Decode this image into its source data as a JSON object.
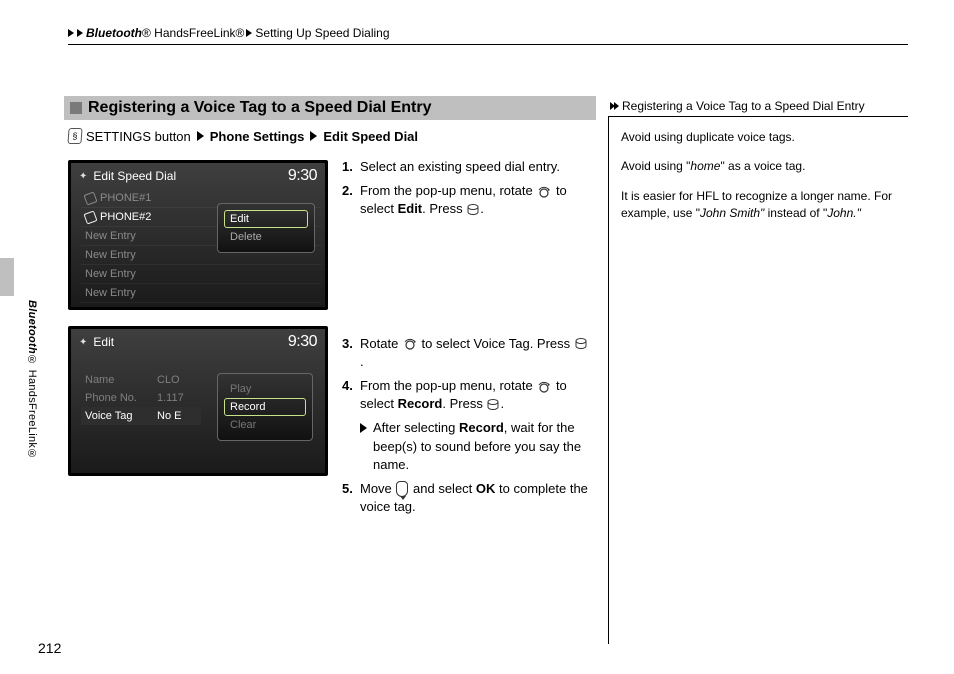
{
  "breadcrumb": {
    "a": "Bluetooth",
    "a_reg": "®",
    "b": " HandsFreeLink®",
    "c": "Setting Up Speed Dialing"
  },
  "side": {
    "a": "Bluetooth",
    "reg": "®",
    "b": " HandsFreeLink®"
  },
  "section_title": "Registering a Voice Tag to a Speed Dial Entry",
  "nav": {
    "a": "SETTINGS button",
    "b": "Phone Settings",
    "c": "Edit Speed Dial"
  },
  "shot1": {
    "title": "Edit Speed Dial",
    "time": "9:30",
    "rows": [
      "PHONE#1",
      "PHONE#2",
      "New Entry",
      "New Entry",
      "New Entry",
      "New Entry"
    ],
    "popup": [
      "Edit",
      "Delete"
    ]
  },
  "shot2": {
    "title": "Edit",
    "time": "9:30",
    "rows": [
      {
        "l": "Name",
        "v": "CLO"
      },
      {
        "l": "Phone No.",
        "v": "1.117"
      },
      {
        "l": "Voice Tag",
        "v": "No E"
      }
    ],
    "popup": [
      "Play",
      "Record",
      "Clear"
    ]
  },
  "steps": {
    "s1": "Select an existing speed dial entry.",
    "s2a": "From the pop-up menu, rotate ",
    "s2b": "to select ",
    "s2c": "Edit",
    "s2d": ". Press ",
    "s3a": "Rotate ",
    "s3b": " to select Voice Tag. Press ",
    "s4a": "From the pop-up menu, rotate ",
    "s4b": "to select ",
    "s4c": "Record",
    "s4d": ". Press ",
    "s4sub_a": "After selecting ",
    "s4sub_b": "Record",
    "s4sub_c": ", wait for the beep(s) to sound before you say the name.",
    "s5a": "Move ",
    "s5b": " and select ",
    "s5c": "OK",
    "s5d": " to complete the voice tag."
  },
  "right": {
    "title": "Registering a Voice Tag to a Speed Dial Entry",
    "p1": "Avoid using duplicate voice tags.",
    "p2a": "Avoid using \"",
    "p2b": "home",
    "p2c": "\" as a voice tag.",
    "p3a": "It is easier for HFL to recognize a longer name. For example, use \"",
    "p3b": "John Smith\"",
    "p3c": " instead of \"",
    "p3d": "John.\""
  },
  "page_number": "212"
}
